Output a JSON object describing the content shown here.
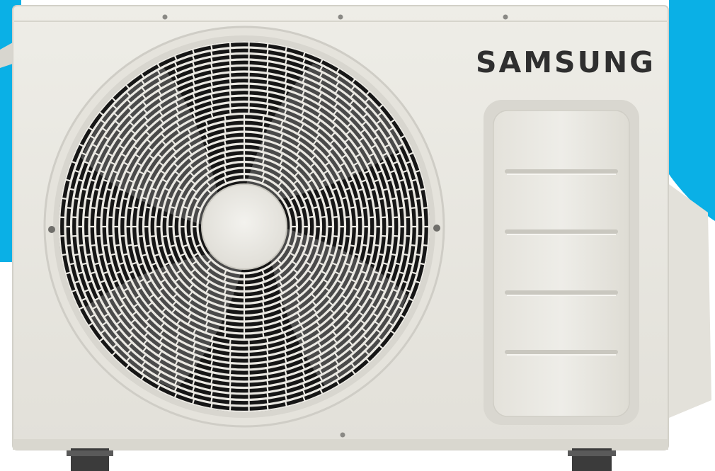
{
  "product": {
    "type": "air conditioner outdoor unit",
    "brand_text": "SAMSUNG"
  },
  "colors": {
    "backdrop": "#0ab0e6",
    "housing": "#ecebe5",
    "housing_shadow": "#d8d6cf",
    "grille_ring": "#e3e1da",
    "fan_blade": "#4a4a4a",
    "wordmark": "#2f2f2f"
  },
  "fan": {
    "blade_count": 4
  },
  "side_panel": {
    "slot_count": 4
  }
}
